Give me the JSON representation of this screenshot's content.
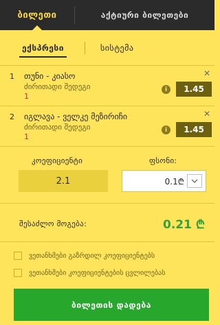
{
  "header": {
    "tabs": [
      {
        "label": "ბილეთი"
      },
      {
        "label": "აქტიური ბილეთები"
      }
    ]
  },
  "subtabs": [
    {
      "label": "ექსპრესი"
    },
    {
      "label": "სისტემა"
    }
  ],
  "bets": [
    {
      "index": "1",
      "title": "თუნი - კიასო",
      "market": "ძირითადი შედეგი",
      "outcome": "1",
      "odds": "1.45"
    },
    {
      "index": "2",
      "title": "იგლავა - ველკე მეზირიჩი",
      "market": "ძირითადი შედეგი",
      "outcome": "1",
      "odds": "1.45"
    }
  ],
  "summary": {
    "coefficient_label": "კოეფიციენტი",
    "coefficient_value": "2.1",
    "stake_label": "ფსონი:",
    "stake_value": "0.1₾",
    "possible_win_label": "შესაძლო მოგება:",
    "possible_win_value": "0.21 ₾"
  },
  "options": [
    {
      "label": "ვეთანხმები გაზრდილ კოეფიციენტებს"
    },
    {
      "label": "ვეთანხმები კოეფიციენტების ცვლილებას"
    }
  ],
  "actions": {
    "place_bet_label": "ბილეთის დადება"
  },
  "icons": {
    "close": "close-icon",
    "info": "info-icon",
    "dropdown": "chevron-down-icon"
  },
  "colors": {
    "accent": "#fde45a",
    "header": "#2b2b2b",
    "odds": "#6d610f",
    "win": "#34a03e",
    "place_button": "#27a72b"
  }
}
